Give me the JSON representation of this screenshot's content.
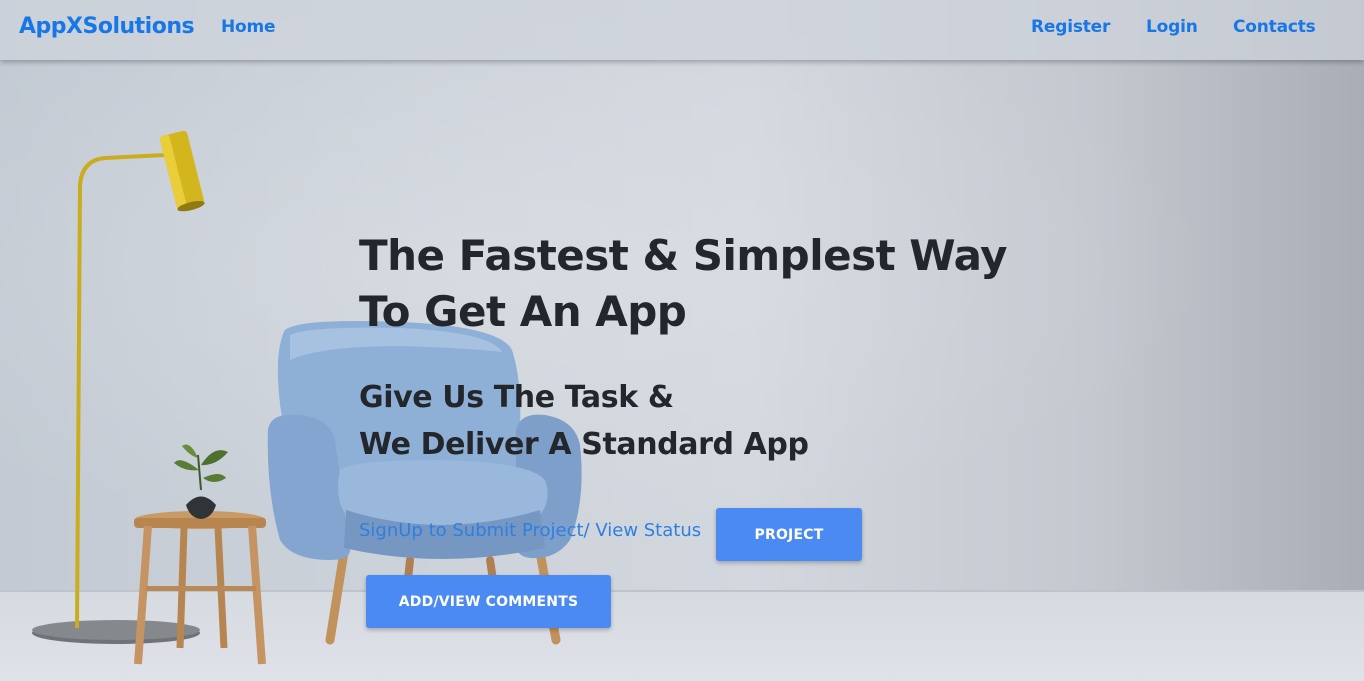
{
  "navbar": {
    "brand": "AppXSolutions",
    "home": "Home",
    "register": "Register",
    "login": "Login",
    "contacts": "Contacts"
  },
  "hero": {
    "title_line1": "The Fastest & Simplest Way",
    "title_line2": "To Get An App",
    "subtitle_line1": "Give Us The Task &",
    "subtitle_line2": "We Deliver A Standard App",
    "signup_link": "SignUp to Submit Project/ View Status",
    "project_button": "PROJECT",
    "comments_button": "ADD/VIEW COMMENTS"
  },
  "colors": {
    "accent": "#1877e6",
    "button": "#4a8af2",
    "heading": "#23262b"
  },
  "background_icons": [
    "floor-lamp-icon",
    "armchair-icon",
    "side-table-icon",
    "plant-vase-icon"
  ]
}
